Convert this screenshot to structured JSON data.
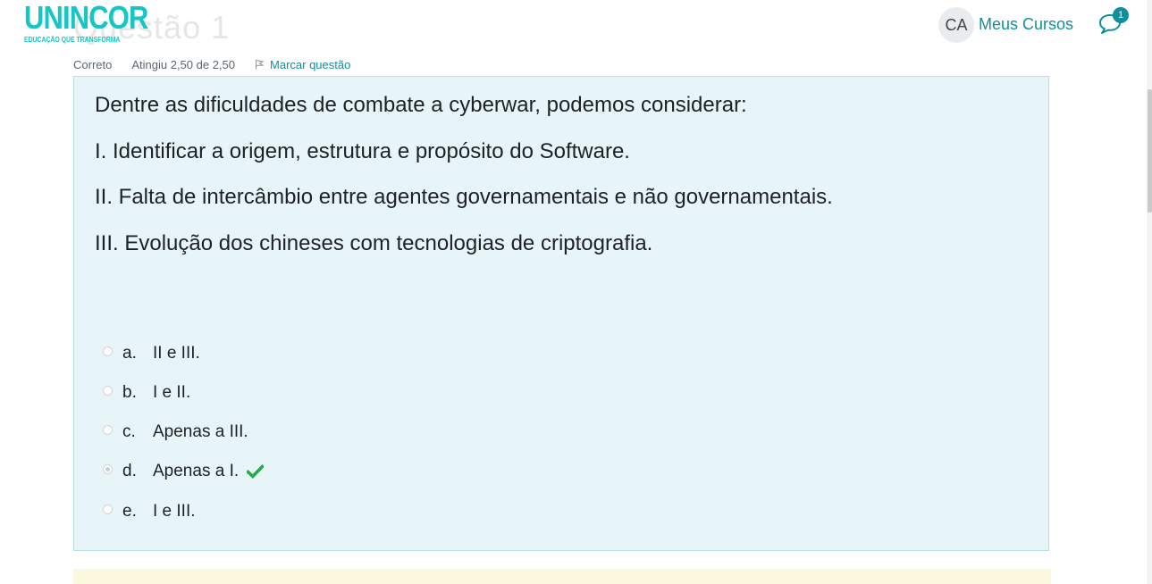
{
  "header": {
    "logo_text": "UNINCOR",
    "logo_tagline": "EDUCAÇÃO QUE TRANSFORMA",
    "avatar_initials": "CA",
    "my_courses_label": "Meus Cursos",
    "messages_badge": "1",
    "brand_color": "#14c6c6",
    "accent_color": "#0f8f9d"
  },
  "question": {
    "title": "Questão 1",
    "state": "Correto",
    "grade": "Atingiu 2,50 de 2,50",
    "flag_label": "Marcar questão",
    "flag_icon": "flag-icon",
    "text_lines": [
      "Dentre as dificuldades de combate a cyberwar, podemos considerar:",
      "I. Identificar a origem, estrutura e propósito do Software.",
      "II. Falta de intercâmbio entre agentes governamentais e não governamentais.",
      "III. Evolução dos chineses com tecnologias de criptografia."
    ],
    "options": [
      {
        "letter": "a.",
        "text": "II e III.",
        "selected": false,
        "correct": false
      },
      {
        "letter": "b.",
        "text": "I e II.",
        "selected": false,
        "correct": false
      },
      {
        "letter": "c.",
        "text": "Apenas a III.",
        "selected": false,
        "correct": false
      },
      {
        "letter": "d.",
        "text": "Apenas a I.",
        "selected": true,
        "correct": true
      },
      {
        "letter": "e.",
        "text": "I e III.",
        "selected": false,
        "correct": false
      }
    ],
    "correct_icon": "check-icon",
    "box_color": "#e7f5f9",
    "correct_color": "#1db045"
  }
}
